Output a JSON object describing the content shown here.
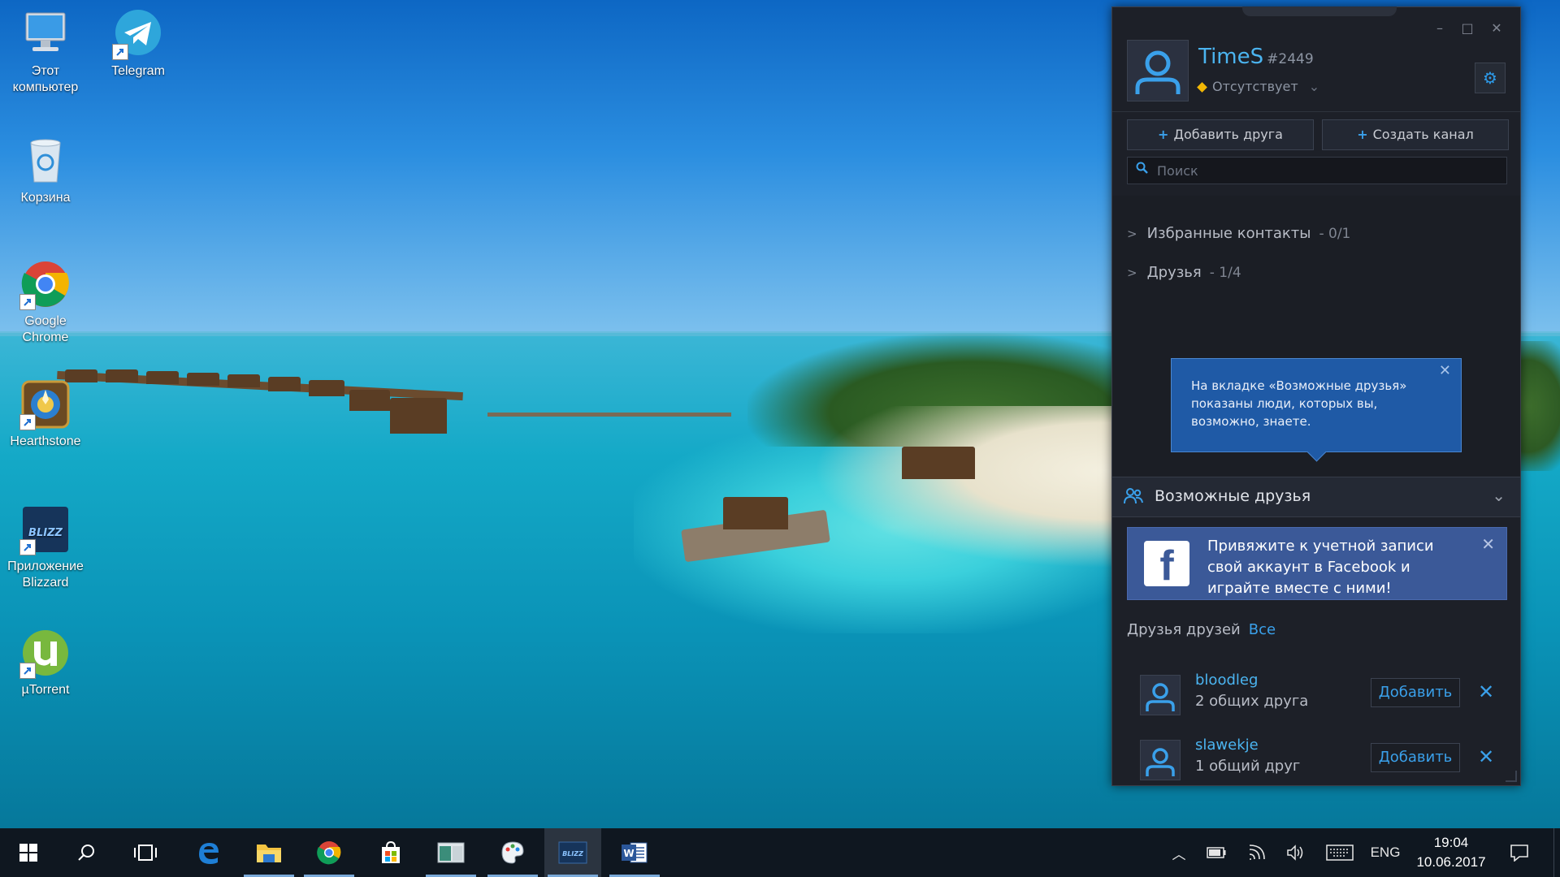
{
  "desktop": {
    "icons": [
      {
        "label_line1": "Этот",
        "label_line2": "компьютер"
      },
      {
        "label_line1": "Telegram",
        "label_line2": ""
      },
      {
        "label_line1": "Корзина",
        "label_line2": ""
      },
      {
        "label_line1": "Google",
        "label_line2": "Chrome"
      },
      {
        "label_line1": "Hearthstone",
        "label_line2": ""
      },
      {
        "label_line1": "Приложение",
        "label_line2": "Blizzard"
      },
      {
        "label_line1": "µTorrent",
        "label_line2": ""
      }
    ]
  },
  "bnet": {
    "window_controls": {
      "minimize": "–",
      "maximize": "□",
      "close": "✕"
    },
    "profile": {
      "name": "TimeS",
      "tag": "#2449",
      "status": "Отсутствует",
      "status_color": "#f2b705"
    },
    "add_friend_label": "Добавить друга",
    "create_channel_label": "Создать канал",
    "search_placeholder": "Поиск",
    "groups": [
      {
        "label": "Избранные контакты",
        "count": "- 0/1"
      },
      {
        "label": "Друзья",
        "count": "- 1/4"
      }
    ],
    "tooltip": {
      "text": "На вкладке «Возможные друзья» показаны люди, которых вы, возможно, знаете."
    },
    "possible_friends": {
      "title": "Возможные друзья",
      "facebook_text": "Привяжите к учетной записи свой аккаунт в Facebook и играйте вместе с ними!",
      "fof_label": "Друзья друзей",
      "fof_all": "Все",
      "friends": [
        {
          "name": "bloodleg",
          "mutual": "2 общих друга",
          "add_label": "Добавить"
        },
        {
          "name": "slawekje",
          "mutual": "1 общий друг",
          "add_label": "Добавить"
        }
      ]
    },
    "accent_color": "#3aa0ea",
    "facebook_color": "#3b5998"
  },
  "taskbar": {
    "language": "ENG",
    "time": "19:04",
    "date": "10.06.2017",
    "apps": [
      "start",
      "search",
      "task-view",
      "edge",
      "file-explorer",
      "chrome",
      "store",
      "generic-app",
      "paint",
      "blizzard",
      "word"
    ]
  }
}
